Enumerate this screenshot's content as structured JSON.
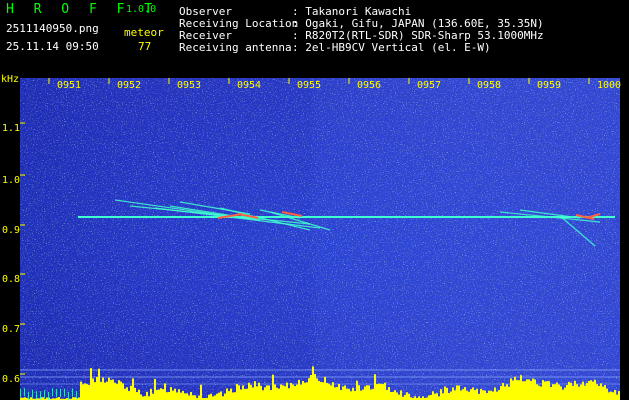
{
  "app": {
    "title": "H R O F F T",
    "version": "1.0.0"
  },
  "file": {
    "name": "2511140950.png",
    "datetime": "25.11.14 09:50"
  },
  "detector": {
    "label": "meteor",
    "count": "77"
  },
  "info": [
    {
      "label": "Observer",
      "value": ": Takanori Kawachi"
    },
    {
      "label": "Receiving Location",
      "value": ": Ogaki, Gifu, JAPAN (136.60E, 35.35N)"
    },
    {
      "label": "Receiver",
      "value": ": R820T2(RTL-SDR) SDR-Sharp 53.1000MHz"
    },
    {
      "label": "Receiving antenna",
      "value": ": 2el-HB9CV Vertical (el. E-W)"
    }
  ],
  "axis": {
    "y_unit": "kHz",
    "y_ticks": [
      "1.1",
      "1.0",
      "0.9",
      "0.8",
      "0.7",
      "0.6"
    ],
    "x_ticks": [
      "0951",
      "0952",
      "0953",
      "0954",
      "0955",
      "0956",
      "0957",
      "0958",
      "0959",
      "1000"
    ]
  },
  "colors": {
    "title": "#00ff00",
    "labels": "#ffff00",
    "info": "#ffffff",
    "spectrum_bg": "#2a3ed0",
    "carrier": "#40ffd0",
    "meteor_trail": "#ff6040",
    "level_bars": "#ffff00"
  }
}
